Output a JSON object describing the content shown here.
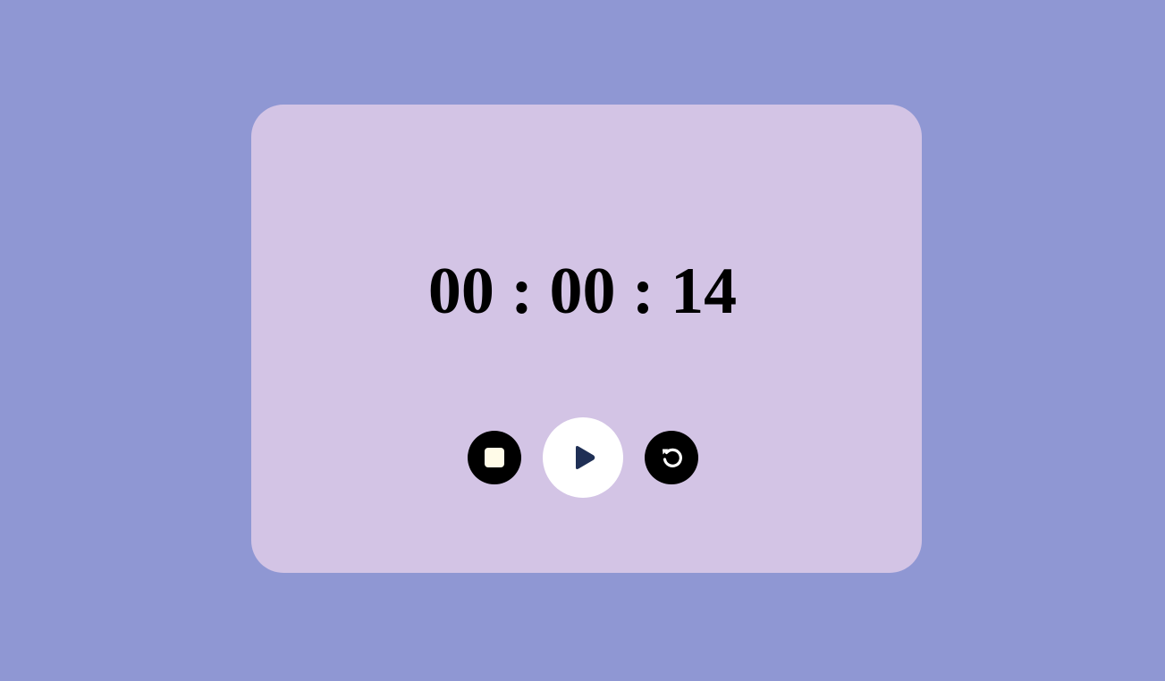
{
  "stopwatch": {
    "time": "00 : 00 : 14"
  },
  "controls": {
    "stop_icon": "stop-icon",
    "play_icon": "play-icon",
    "reset_icon": "reset-icon"
  },
  "colors": {
    "background": "#8f97d3",
    "card": "#d3c4e5",
    "play_glyph": "#1f2f55"
  }
}
